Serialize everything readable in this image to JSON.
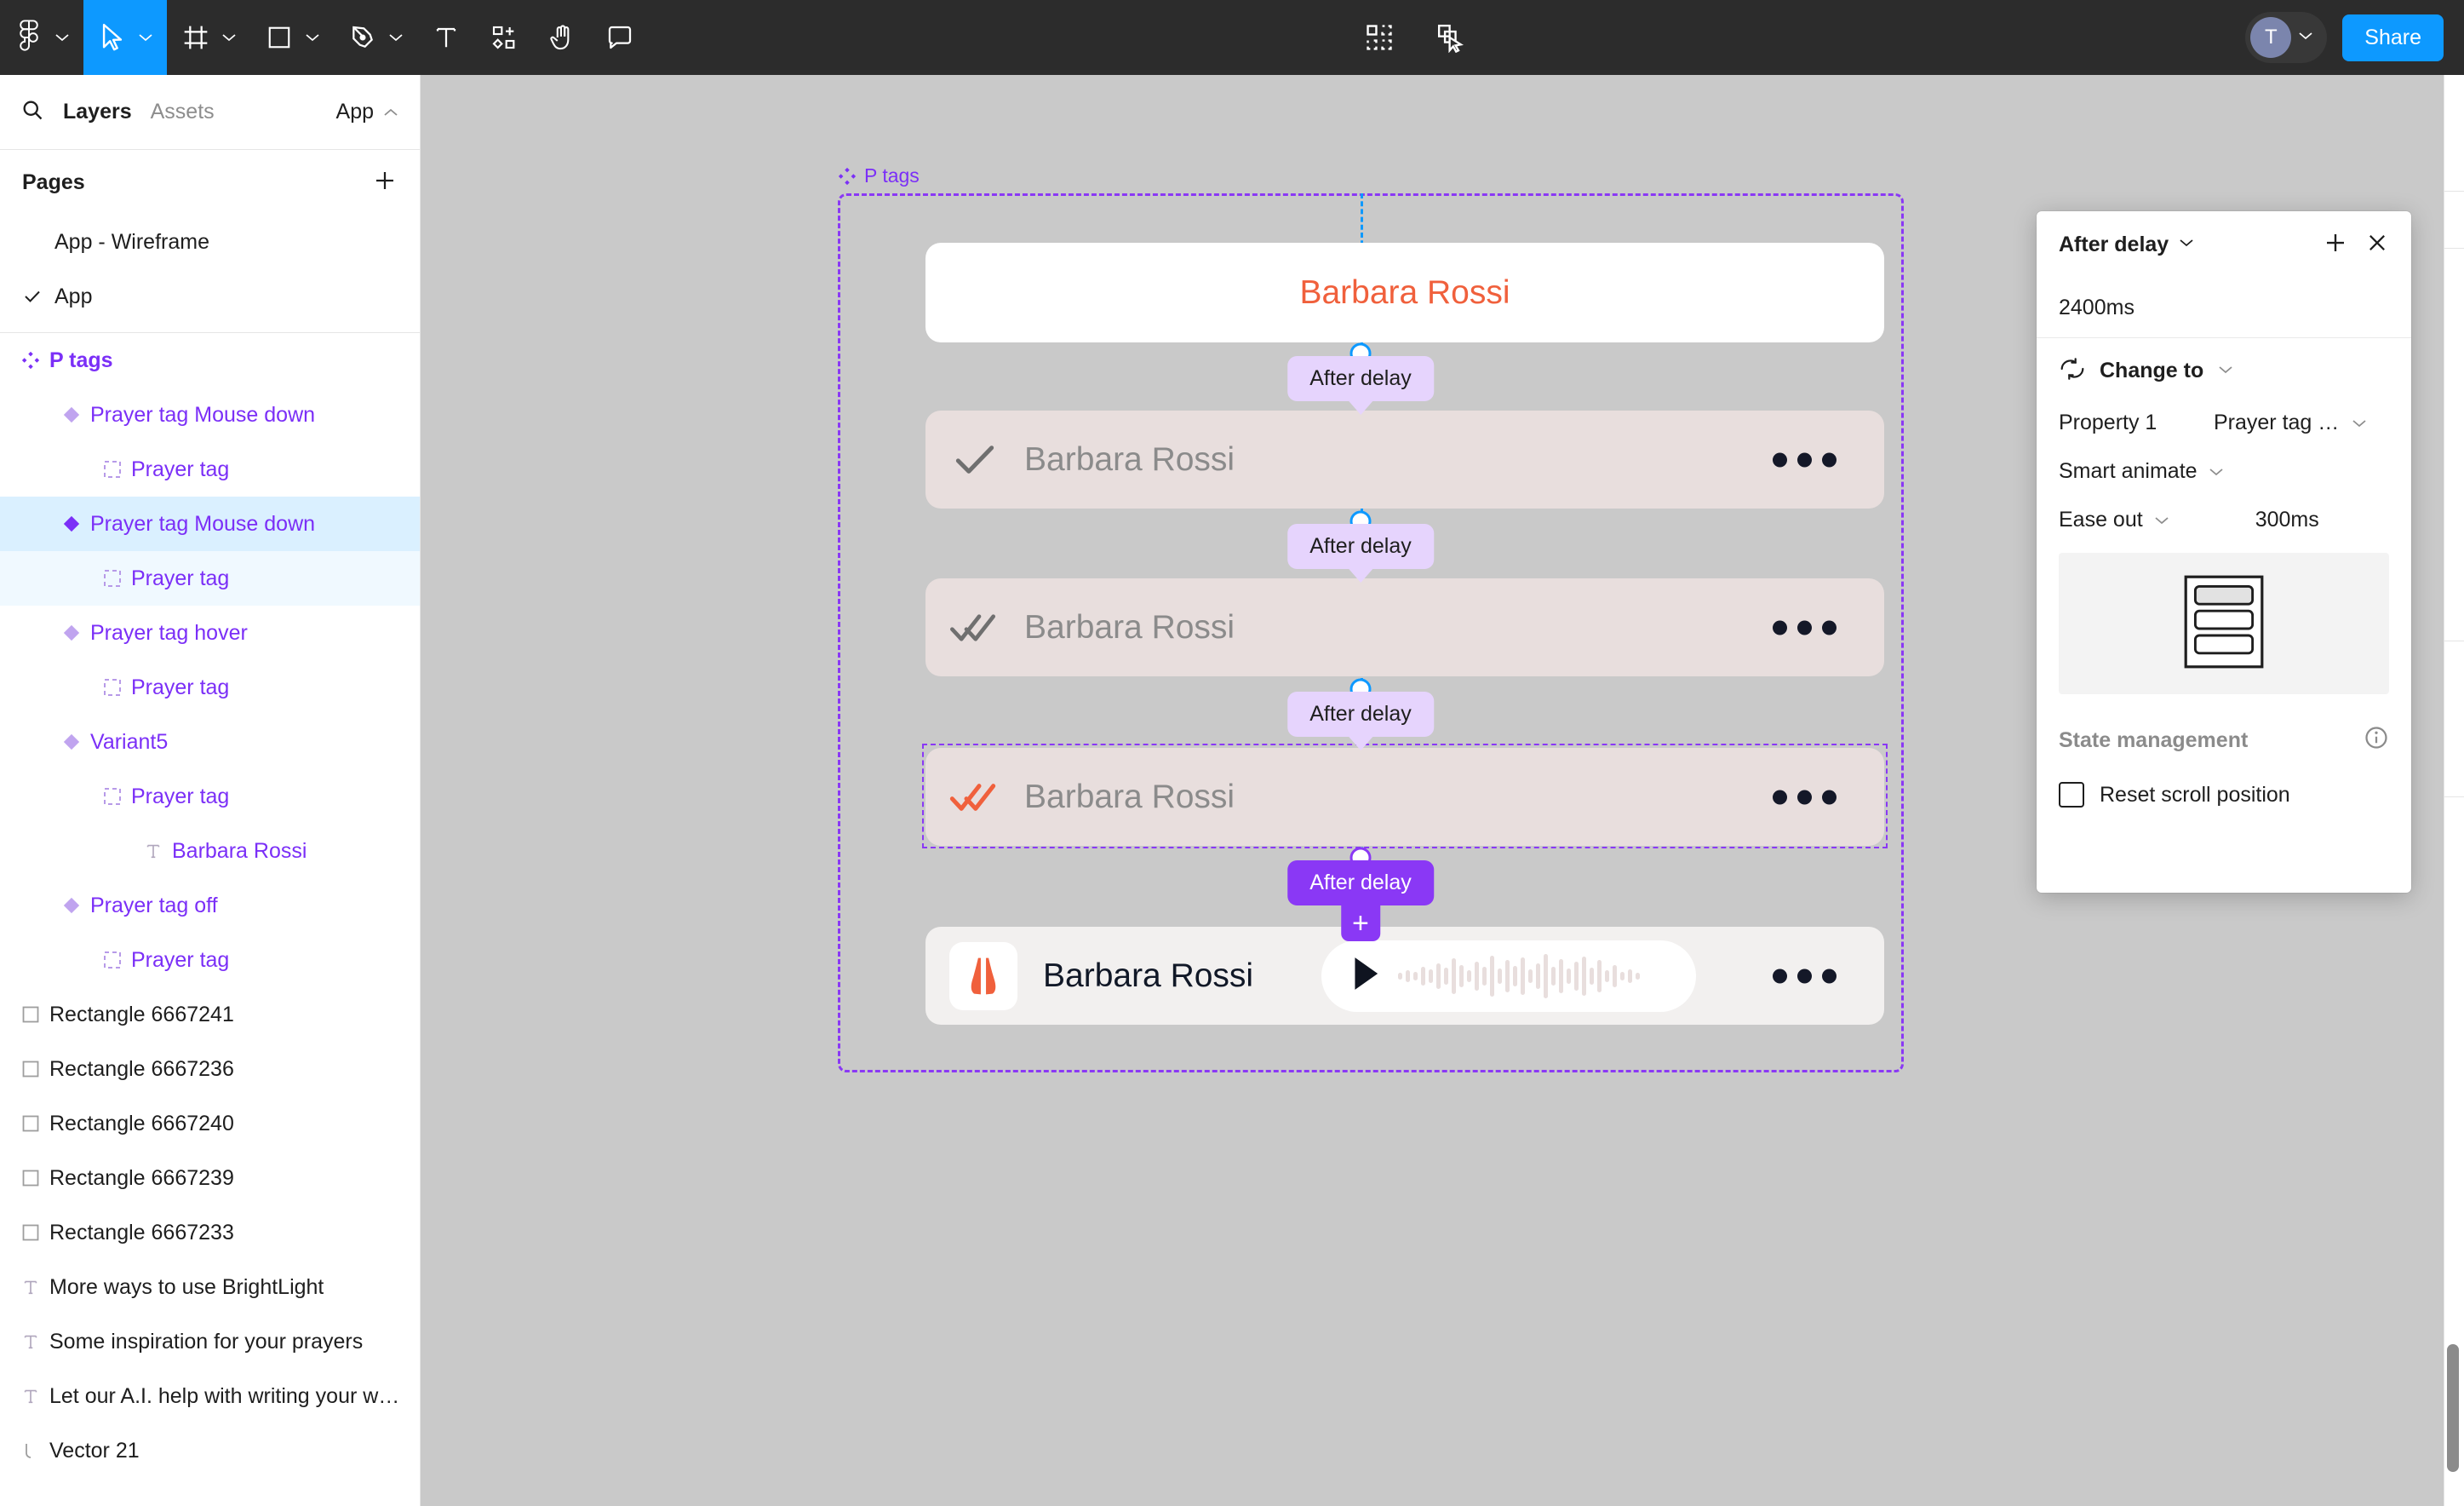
{
  "toolbar": {
    "tools": [
      {
        "name": "figma-logo-icon",
        "label": "Figma",
        "has_chevron": true,
        "active": false
      },
      {
        "name": "move-tool-icon",
        "label": "Move",
        "has_chevron": true,
        "active": true
      },
      {
        "name": "frame-tool-icon",
        "label": "Frame",
        "has_chevron": true,
        "active": false
      },
      {
        "name": "shape-tool-icon",
        "label": "Rectangle",
        "has_chevron": true,
        "active": false
      },
      {
        "name": "pen-tool-icon",
        "label": "Pen",
        "has_chevron": true,
        "active": false
      },
      {
        "name": "text-tool-icon",
        "label": "Text",
        "has_chevron": false,
        "active": false
      },
      {
        "name": "actions-tool-icon",
        "label": "Actions",
        "has_chevron": false,
        "active": false
      },
      {
        "name": "hand-tool-icon",
        "label": "Hand",
        "has_chevron": false,
        "active": false
      },
      {
        "name": "comment-tool-icon",
        "label": "Comment",
        "has_chevron": false,
        "active": false
      }
    ],
    "center_tools": [
      {
        "name": "component-tool-icon",
        "label": "Components"
      },
      {
        "name": "select-copy-icon",
        "label": "Select parent"
      }
    ],
    "avatar_initial": "T",
    "share_label": "Share",
    "accent_blue": "#0d99ff",
    "bar_bg": "#2c2c2c"
  },
  "left_panel": {
    "search_icon": "search-icon",
    "tabs": [
      {
        "label": "Layers",
        "active": true
      },
      {
        "label": "Assets",
        "active": false
      }
    ],
    "file_name": "App",
    "pages_label": "Pages",
    "add_page_label": "+",
    "pages": [
      {
        "label": "App - Wireframe",
        "selected": false
      },
      {
        "label": "App",
        "selected": true
      }
    ],
    "layers": [
      {
        "label": "P tags",
        "indent": 0,
        "icon": "component-set-icon",
        "style": "purple-bold",
        "selected": "none"
      },
      {
        "label": "Prayer tag Mouse down",
        "indent": 1,
        "icon": "component-icon-faded",
        "style": "purple",
        "selected": "none"
      },
      {
        "label": "Prayer tag",
        "indent": 2,
        "icon": "instance-dashed-icon",
        "style": "purple",
        "selected": "none"
      },
      {
        "label": "Prayer tag Mouse down",
        "indent": 1,
        "icon": "component-icon",
        "style": "purple",
        "selected": "strong"
      },
      {
        "label": "Prayer tag",
        "indent": 2,
        "icon": "instance-dashed-icon",
        "style": "purple",
        "selected": "weak"
      },
      {
        "label": "Prayer tag hover",
        "indent": 1,
        "icon": "component-icon-faded",
        "style": "purple",
        "selected": "none"
      },
      {
        "label": "Prayer tag",
        "indent": 2,
        "icon": "instance-dashed-icon",
        "style": "purple",
        "selected": "none"
      },
      {
        "label": "Variant5",
        "indent": 1,
        "icon": "component-icon-faded",
        "style": "purple",
        "selected": "none"
      },
      {
        "label": "Prayer tag",
        "indent": 2,
        "icon": "instance-dashed-icon",
        "style": "purple",
        "selected": "none"
      },
      {
        "label": "Barbara Rossi",
        "indent": 3,
        "icon": "text-layer-icon",
        "style": "purple",
        "selected": "none"
      },
      {
        "label": "Prayer tag off",
        "indent": 1,
        "icon": "component-icon-faded",
        "style": "purple",
        "selected": "none"
      },
      {
        "label": "Prayer tag",
        "indent": 2,
        "icon": "instance-dashed-icon",
        "style": "purple",
        "selected": "none"
      },
      {
        "label": "Rectangle 6667241",
        "indent": 0,
        "icon": "rectangle-layer-icon",
        "style": "dark",
        "selected": "none"
      },
      {
        "label": "Rectangle 6667236",
        "indent": 0,
        "icon": "rectangle-layer-icon",
        "style": "dark",
        "selected": "none"
      },
      {
        "label": "Rectangle 6667240",
        "indent": 0,
        "icon": "rectangle-layer-icon",
        "style": "dark",
        "selected": "none"
      },
      {
        "label": "Rectangle 6667239",
        "indent": 0,
        "icon": "rectangle-layer-icon",
        "style": "dark",
        "selected": "none"
      },
      {
        "label": "Rectangle 6667233",
        "indent": 0,
        "icon": "rectangle-layer-icon",
        "style": "dark",
        "selected": "none"
      },
      {
        "label": "More ways to use BrightLight",
        "indent": 0,
        "icon": "text-layer-icon",
        "style": "dark",
        "selected": "none"
      },
      {
        "label": "Some inspiration for your prayers",
        "indent": 0,
        "icon": "text-layer-icon",
        "style": "dark",
        "selected": "none"
      },
      {
        "label": "Let our A.I. help with writing your w…",
        "indent": 0,
        "icon": "text-layer-icon",
        "style": "dark",
        "selected": "none"
      },
      {
        "label": "Vector 21",
        "indent": 0,
        "icon": "vector-layer-icon",
        "style": "dark",
        "selected": "none"
      }
    ]
  },
  "canvas": {
    "frame_label": "P tags",
    "frame_color": "#8a38f5",
    "background": "#c9c9c9",
    "cards": [
      {
        "name": "Barbara Rossi",
        "variant": "default-white",
        "check": "none",
        "has_dots": false,
        "name_color": "#f0603c"
      },
      {
        "name": "Barbara Rossi",
        "variant": "tinted",
        "check": "single-gray",
        "has_dots": true,
        "name_color": "#8b8b8b"
      },
      {
        "name": "Barbara Rossi",
        "variant": "tinted",
        "check": "double-gray",
        "has_dots": true,
        "name_color": "#8b8b8b"
      },
      {
        "name": "Barbara Rossi",
        "variant": "tinted-selected",
        "check": "double-orange",
        "has_dots": true,
        "name_color": "#8b8b8b"
      },
      {
        "name": "Barbara Rossi",
        "variant": "audio",
        "check": "none",
        "has_dots": true,
        "name_color": "#111827"
      }
    ],
    "connections": [
      {
        "label": "After delay",
        "selected": false
      },
      {
        "label": "After delay",
        "selected": false
      },
      {
        "label": "After delay",
        "selected": false
      },
      {
        "label": "After delay",
        "selected": true,
        "plus": "+"
      }
    ],
    "connection_color": "#0d99ff",
    "badge_color": "#e6d4fd",
    "badge_selected_color": "#8a38f5"
  },
  "popup": {
    "title": "After delay",
    "title_chevron": "chevron-down-icon",
    "add_label": "+",
    "close_label": "×",
    "delay_value": "2400ms",
    "action": {
      "icon": "change-to-icon",
      "label": "Change to",
      "chevron": "chevron-down-icon"
    },
    "property": {
      "label": "Property 1",
      "value": "Prayer tag …"
    },
    "animation": {
      "type": "Smart animate",
      "easing": "Ease out",
      "duration": "300ms"
    },
    "preview_icon": "list-frame-preview-icon",
    "state_management_label": "State management",
    "info_icon": "info-icon",
    "reset_scroll_label": "Reset scroll position",
    "reset_scroll_checked": false
  }
}
